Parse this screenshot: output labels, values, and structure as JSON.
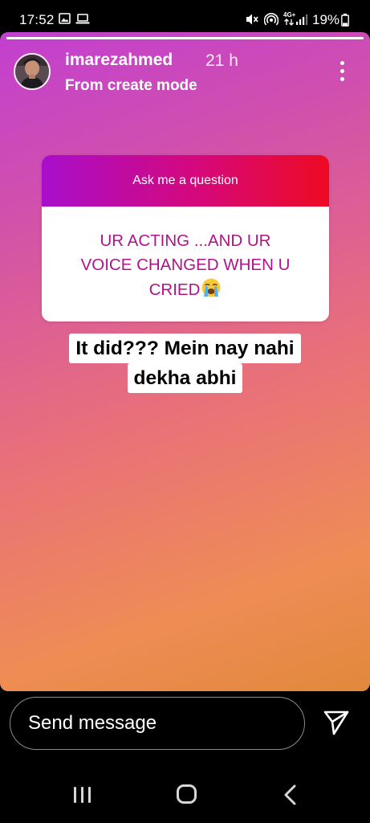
{
  "status_bar": {
    "time": "17:52",
    "battery_percent": "19%",
    "left_icons": [
      "gallery-icon",
      "laptop-icon"
    ],
    "right_icons": [
      "mute-vibrate-icon",
      "hotspot-icon",
      "lte-signal-icon",
      "battery-icon"
    ],
    "network_label": "4G+"
  },
  "story": {
    "progress": 1.0,
    "username": "imarezahmed",
    "time_ago": "21 h",
    "subtitle": "From create mode",
    "gradient_colors": [
      "#c23fd0",
      "#e8707a",
      "#e0893b"
    ]
  },
  "question_sticker": {
    "header": "Ask me a question",
    "body_lines": [
      "UR ACTING ...AND UR",
      "VOICE CHANGED WHEN U",
      "CRIED"
    ],
    "emoji": "crying-face",
    "header_gradient": [
      "#a80ecb",
      "#ee0a22"
    ],
    "text_color": "#b01389"
  },
  "answer": {
    "lines": [
      "It did??? Mein nay nahi",
      "dekha abhi"
    ]
  },
  "bottom_bar": {
    "message_placeholder": "Send message",
    "send_icon": "paper-plane-icon"
  },
  "nav_bar": {
    "icons": [
      "recent-apps-icon",
      "home-icon",
      "back-icon"
    ]
  }
}
